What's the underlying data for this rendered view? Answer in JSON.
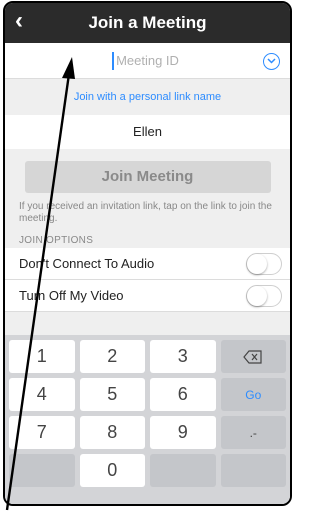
{
  "header": {
    "back_icon": "back-chevron-icon",
    "title": "Join a Meeting"
  },
  "meeting_id": {
    "placeholder": "Meeting ID",
    "dropdown_icon": "chevron-down-icon"
  },
  "personal_link": {
    "label": "Join with a personal link name"
  },
  "name_field": {
    "value": "Ellen"
  },
  "join_button": {
    "label": "Join Meeting"
  },
  "hint": {
    "text": "If you received an invitation link, tap on the link to join the meeting."
  },
  "options": {
    "section_label": "JOIN OPTIONS",
    "items": [
      {
        "label": "Don't Connect To Audio",
        "enabled": false
      },
      {
        "label": "Turn Off My Video",
        "enabled": false
      }
    ]
  },
  "keypad": {
    "keys": [
      "1",
      "2",
      "3",
      "backspace",
      "4",
      "5",
      "6",
      "Go",
      "7",
      "8",
      "9",
      ".-",
      "",
      "0",
      "",
      ""
    ]
  },
  "colors": {
    "accent": "#2d8cff",
    "header_bg": "#2b2b2b",
    "keypad_bg": "#d3d4d7"
  }
}
